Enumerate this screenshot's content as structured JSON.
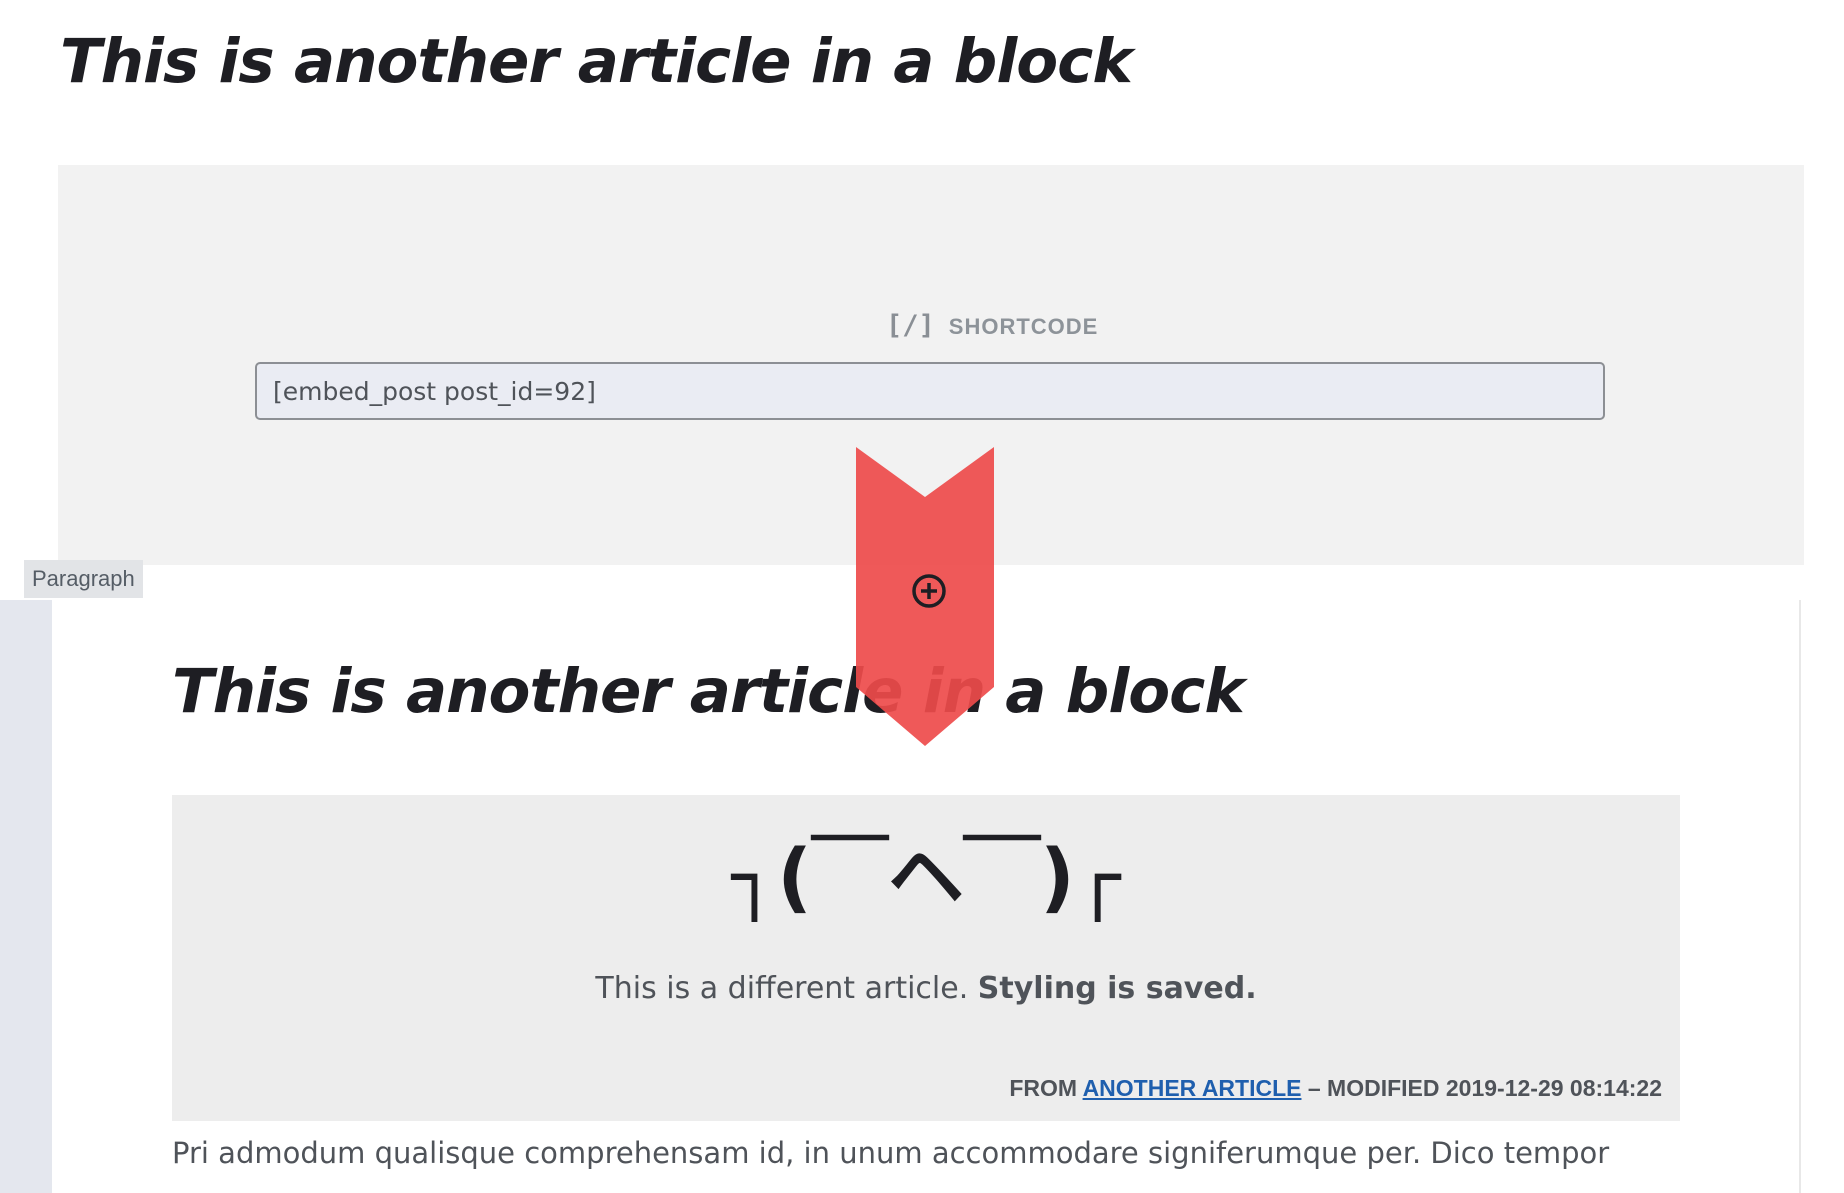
{
  "top": {
    "title": "This is another article in a block"
  },
  "shortcode": {
    "icon_glyph": "[/]",
    "icon_name": "shortcode-icon",
    "label": "SHORTCODE",
    "value": "[embed_post post_id=92]"
  },
  "paragraph_tag": {
    "label": "Paragraph"
  },
  "embed": {
    "title": "This is another article in a block",
    "shrug": "┐(￣ヘ￣)┌",
    "text_plain": "This is a different article. ",
    "text_bold": "Styling is saved.",
    "meta_prefix": "FROM ",
    "meta_link": "ANOTHER ARTICLE",
    "meta_suffix": " – MODIFIED 2019-12-29 08:14:22"
  },
  "body": {
    "text": "Pri admodum qualisque comprehensam id, in unum accommodare signiferumque per. Dico tempor"
  },
  "insert": {
    "icon_name": "plus-circle-icon"
  },
  "indicator": {
    "icon_name": "arrow-down-indicator",
    "color": "#ee4b4b"
  }
}
